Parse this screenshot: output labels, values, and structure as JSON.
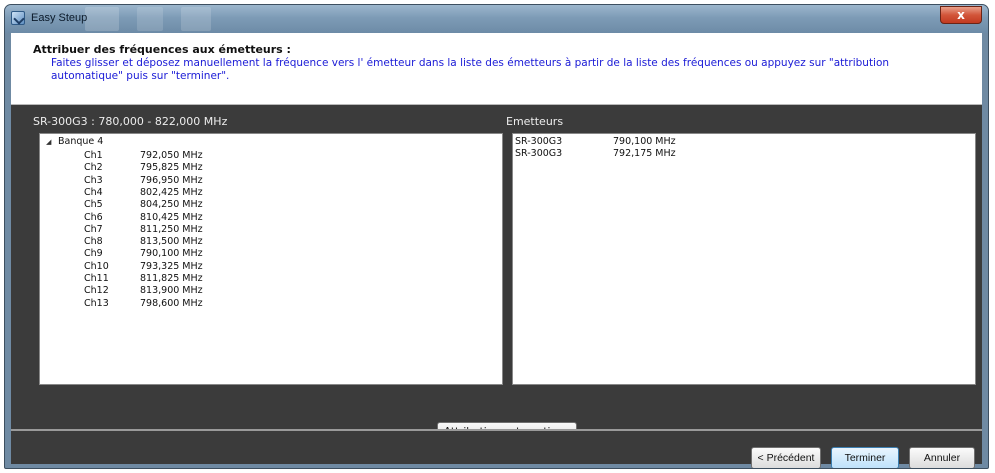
{
  "window": {
    "title": "Easy Steup",
    "close_label": "x"
  },
  "header": {
    "title": "Attribuer des fréquences aux émetteurs :",
    "description": "Faites glisser et déposez manuellement la fréquence vers l' émetteur dans la liste des émetteurs à partir de la liste des fréquences ou appuyez sur \"attribution automatique\" puis sur \"terminer\"."
  },
  "frequency_list": {
    "label": "SR-300G3 : 780,000 - 822,000 MHz",
    "group_toggle": "◢",
    "group_label": "Banque 4",
    "channels": [
      {
        "name": "Ch1",
        "freq": "792,050 MHz"
      },
      {
        "name": "Ch2",
        "freq": "795,825 MHz"
      },
      {
        "name": "Ch3",
        "freq": "796,950 MHz"
      },
      {
        "name": "Ch4",
        "freq": "802,425 MHz"
      },
      {
        "name": "Ch5",
        "freq": "804,250 MHz"
      },
      {
        "name": "Ch6",
        "freq": "810,425 MHz"
      },
      {
        "name": "Ch7",
        "freq": "811,250 MHz"
      },
      {
        "name": "Ch8",
        "freq": "813,500 MHz"
      },
      {
        "name": "Ch9",
        "freq": "790,100 MHz"
      },
      {
        "name": "Ch10",
        "freq": "793,325 MHz"
      },
      {
        "name": "Ch11",
        "freq": "811,825 MHz"
      },
      {
        "name": "Ch12",
        "freq": "813,900 MHz"
      },
      {
        "name": "Ch13",
        "freq": "798,600 MHz"
      }
    ]
  },
  "emitters": {
    "label": "Emetteurs",
    "items": [
      {
        "model": "SR-300G3",
        "freq": "790,100 MHz"
      },
      {
        "model": "SR-300G3",
        "freq": "792,175 MHz"
      }
    ]
  },
  "buttons": {
    "auto_assign": "Attribution automatique",
    "previous": "< Précédent",
    "finish": "Terminer",
    "cancel": "Annuler"
  }
}
